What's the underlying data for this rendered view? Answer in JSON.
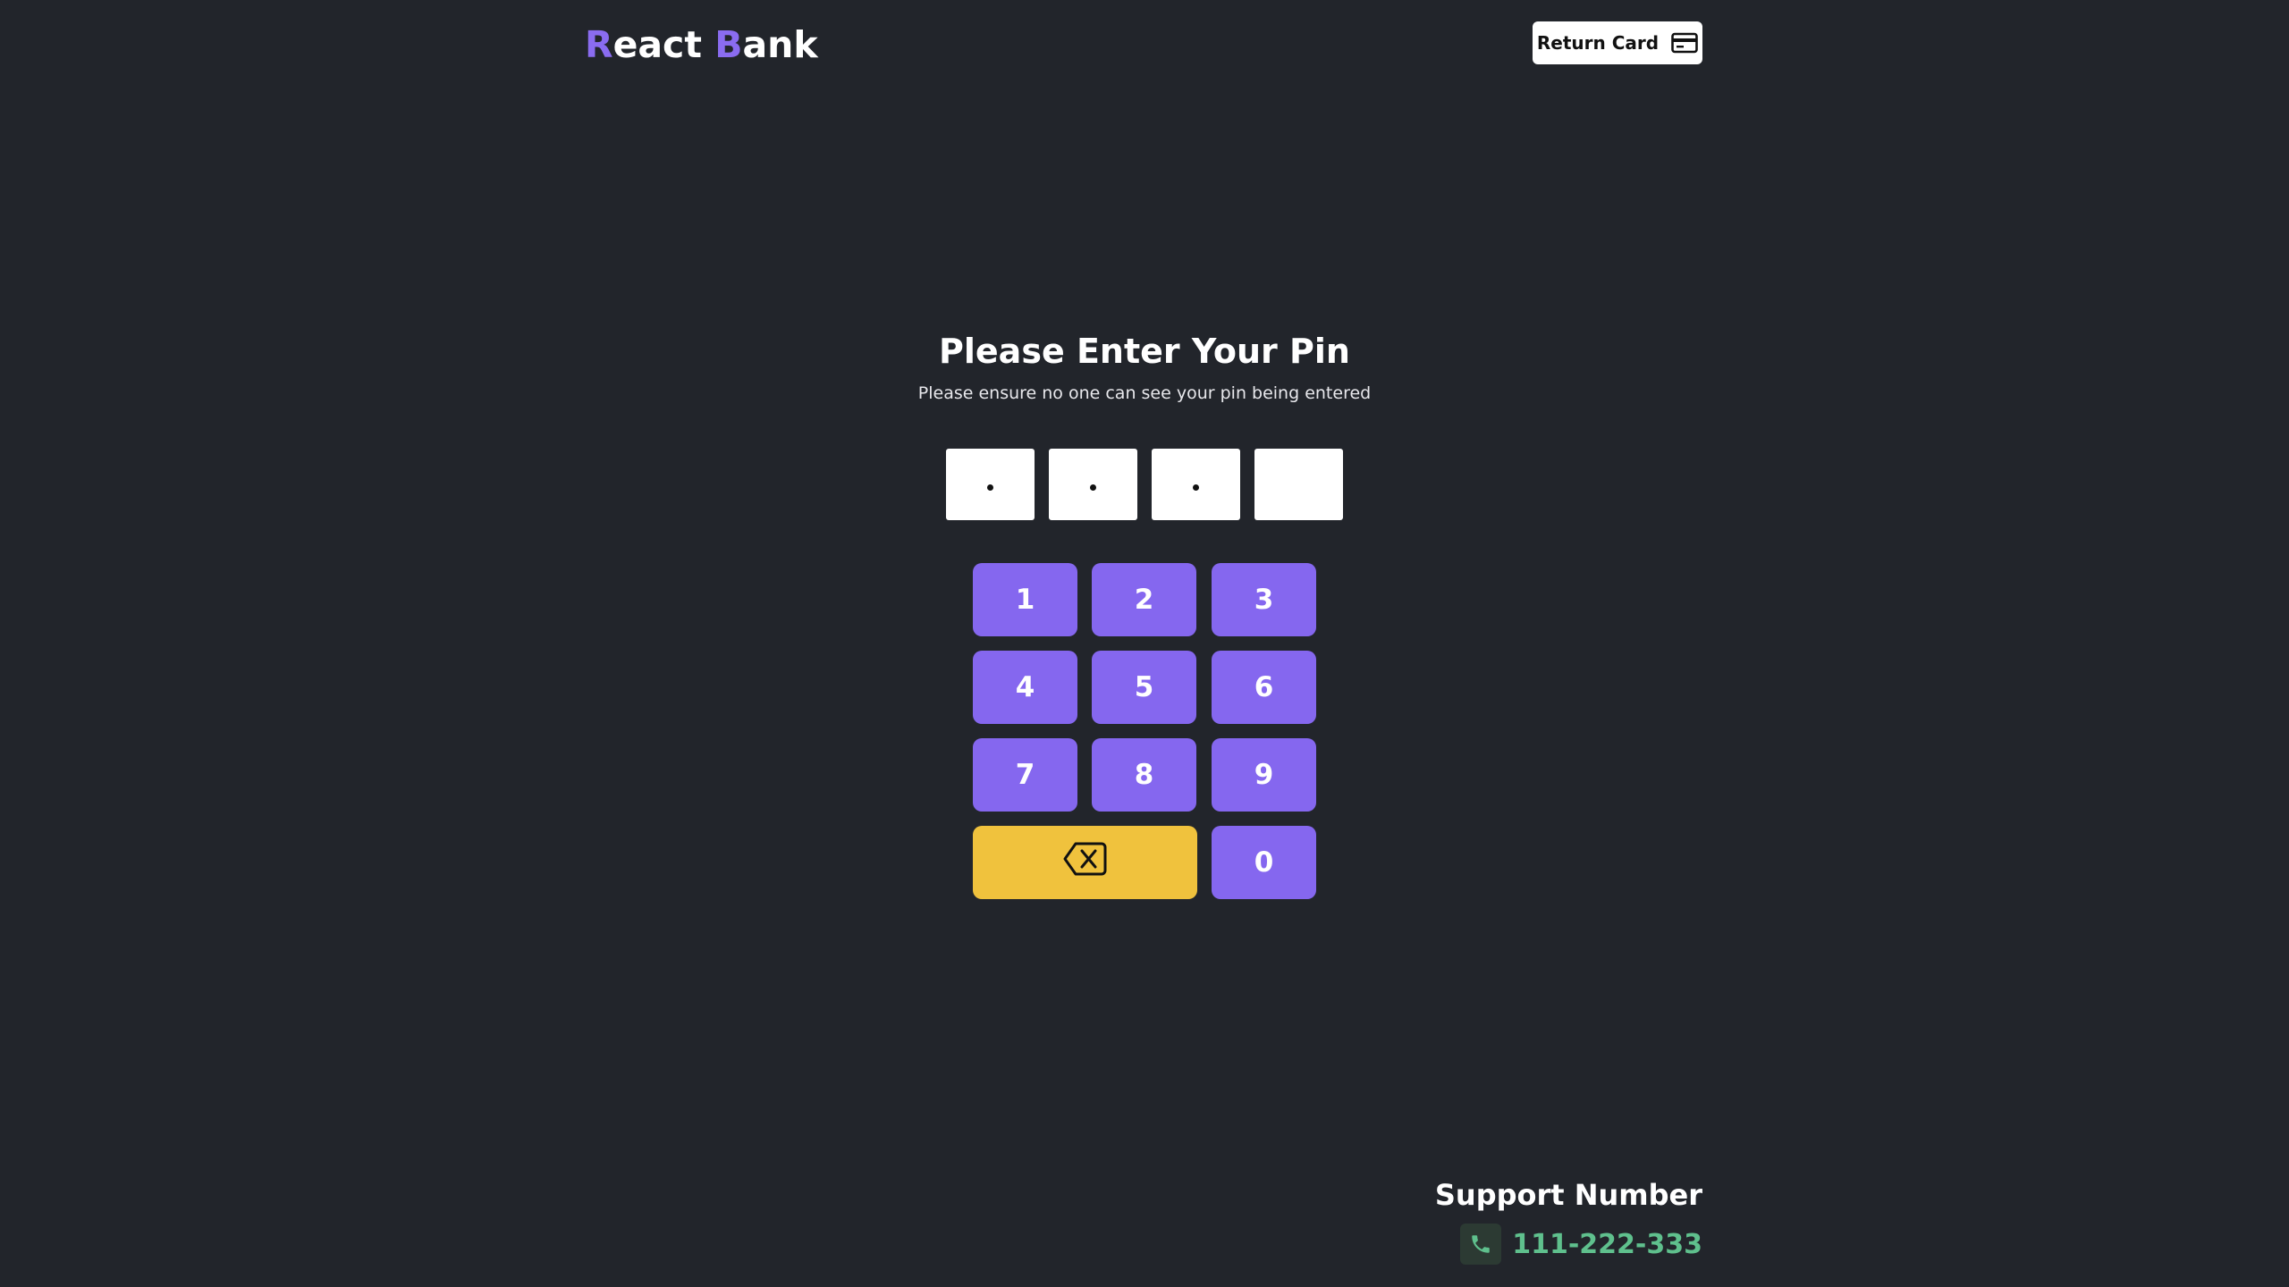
{
  "header": {
    "logo": {
      "first_initial": "R",
      "first_rest": "eact",
      "second_initial": "B",
      "second_rest": "ank"
    },
    "return_card_label": "Return Card"
  },
  "main": {
    "title": "Please Enter Your Pin",
    "subtitle": "Please ensure no one can see your pin being entered",
    "pin": {
      "length": 4,
      "filled": 3
    },
    "keypad": {
      "keys": [
        "1",
        "2",
        "3",
        "4",
        "5",
        "6",
        "7",
        "8",
        "9",
        "0"
      ],
      "backspace_icon": "backspace-icon"
    }
  },
  "support": {
    "title": "Support Number",
    "phone_icon": "phone-icon",
    "number": "111-222-333"
  },
  "colors": {
    "background": "#22252b",
    "accent": "#8a6cf0",
    "key": "#8567ef",
    "backspace_key": "#f0c23d",
    "phone_number": "#5fc08d"
  }
}
